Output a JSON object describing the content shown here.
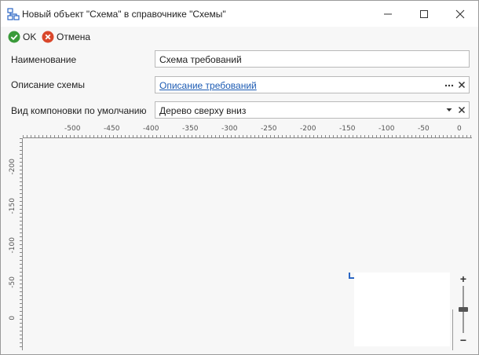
{
  "window": {
    "title": "Новый объект \"Схема\" в справочнике \"Схемы\"",
    "icon": "schema-icon"
  },
  "toolbar": {
    "ok_label": "OK",
    "cancel_label": "Отмена"
  },
  "form": {
    "name_label": "Наименование",
    "name_value": "Схема требований",
    "description_label": "Описание схемы",
    "description_value": "Описание требований",
    "layout_label": "Вид компоновки по умолчанию",
    "layout_value": "Дерево сверху вниз"
  },
  "ruler": {
    "top_labels": [
      "-500",
      "-450",
      "-400",
      "-350",
      "-300",
      "-250",
      "-200",
      "-150",
      "-100",
      "-50",
      "0"
    ],
    "left_labels": [
      "-200",
      "-150",
      "-100",
      "-50",
      "0"
    ]
  },
  "zoom": {
    "plus_label": "+",
    "minus_label": "−"
  },
  "colors": {
    "accent": "#2b66c4",
    "link": "#1c5bb3",
    "ok_green": "#3a9a3a",
    "cancel_red": "#d9472b"
  }
}
